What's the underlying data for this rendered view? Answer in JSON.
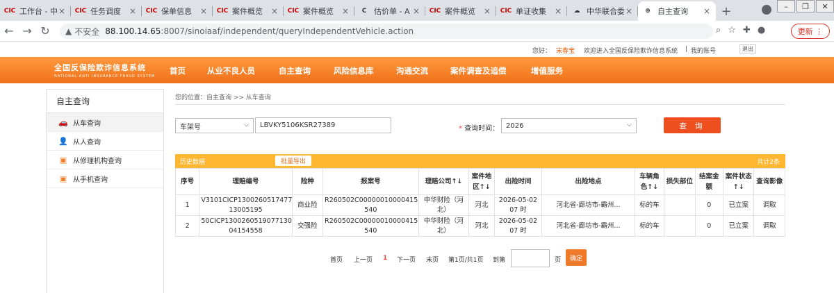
{
  "browser": {
    "tabs": [
      {
        "fav": "CIC",
        "title": "工作台 - 中",
        "active": false
      },
      {
        "fav": "CIC",
        "title": "任务调度",
        "active": false
      },
      {
        "fav": "CIC",
        "title": "保单信息",
        "active": false
      },
      {
        "fav": "CIC",
        "title": "案件概览",
        "active": false
      },
      {
        "fav": "CIC",
        "title": "案件概览",
        "active": false
      },
      {
        "fav": "C",
        "title": "估价单 - A",
        "active": false
      },
      {
        "fav": "CIC",
        "title": "案件概览",
        "active": false
      },
      {
        "fav": "CIC",
        "title": "单证收集",
        "active": false
      },
      {
        "fav": "☁",
        "title": "中华联合委",
        "active": false
      },
      {
        "fav": "⊕",
        "title": "自主查询",
        "active": true
      }
    ],
    "new_tab": "+",
    "security": "不安全",
    "url_host": "88.100.14.65",
    "url_path": ":8007/sinoiaaf/independent/queryIndependentVehicle.action",
    "update_label": "更新"
  },
  "site": {
    "greeting_label": "您好：",
    "user_name": "宋春宝",
    "welcome": "欢迎进入全国反保险欺诈信息系统",
    "separator": "|",
    "my_account": "我的账号",
    "exit_label": "退出",
    "logo_cn": "全国反保险欺诈信息系统",
    "logo_en": "NATIONAL ANTI INSURANCE FRAUD SYSTEM",
    "nav": [
      "首页",
      "从业不良人员",
      "自主查询",
      "风险信息库",
      "沟通交流",
      "案件调查及追偿",
      "增值服务"
    ]
  },
  "sidebar": {
    "title": "自主查询",
    "items": [
      {
        "label": "从车查询",
        "icon": "car-icon",
        "active": true
      },
      {
        "label": "从人查询",
        "icon": "person-icon",
        "active": false
      },
      {
        "label": "从修理机构查询",
        "icon": "repair-shop-icon",
        "active": false
      },
      {
        "label": "从手机查询",
        "icon": "phone-icon",
        "active": false
      }
    ]
  },
  "breadcrumb": "您的位置：自主查询 >> 从车查询",
  "search": {
    "field_type": "车架号",
    "field_value": "LBVKY5106KSR27389",
    "time_label": "查询时间：",
    "required_mark": "*",
    "time_value": "2026",
    "query_button": "查 询"
  },
  "results": {
    "header_left": "历史数据",
    "export_button": "批量导出",
    "total": "共计2条",
    "columns": [
      "序号",
      "理赔编号",
      "险种",
      "报案号",
      "理赔公司↑↓",
      "案件地区↑↓",
      "出险时间",
      "出险地点",
      "车辆角色↑↓",
      "损失部位",
      "结案金额",
      "案件状态↑↓",
      "查询影像"
    ],
    "rows": [
      [
        "1",
        "V3101CICP1300260517477 13005195",
        "商业险",
        "R260502C00000010000415 540",
        "中华财险（河北）",
        "河北",
        "2026-05-02 07 时",
        "河北省-廊坊市-霸州...",
        "标的车",
        "",
        "0",
        "已立案",
        "调取"
      ],
      [
        "2",
        "50CICP1300260519077130 04154558",
        "交强险",
        "R260502C00000010000415 540",
        "中华财险（河北）",
        "河北",
        "2026-05-02 07 时",
        "河北省-廊坊市-霸州...",
        "标的车",
        "",
        "0",
        "已立案",
        "调取"
      ]
    ]
  },
  "pager": {
    "first": "首页",
    "prev": "上一页",
    "current": "1",
    "next": "下一页",
    "last": "末页",
    "info": "第1页/共1页",
    "goto": "到第",
    "page_unit": "页",
    "ok": "确定"
  }
}
